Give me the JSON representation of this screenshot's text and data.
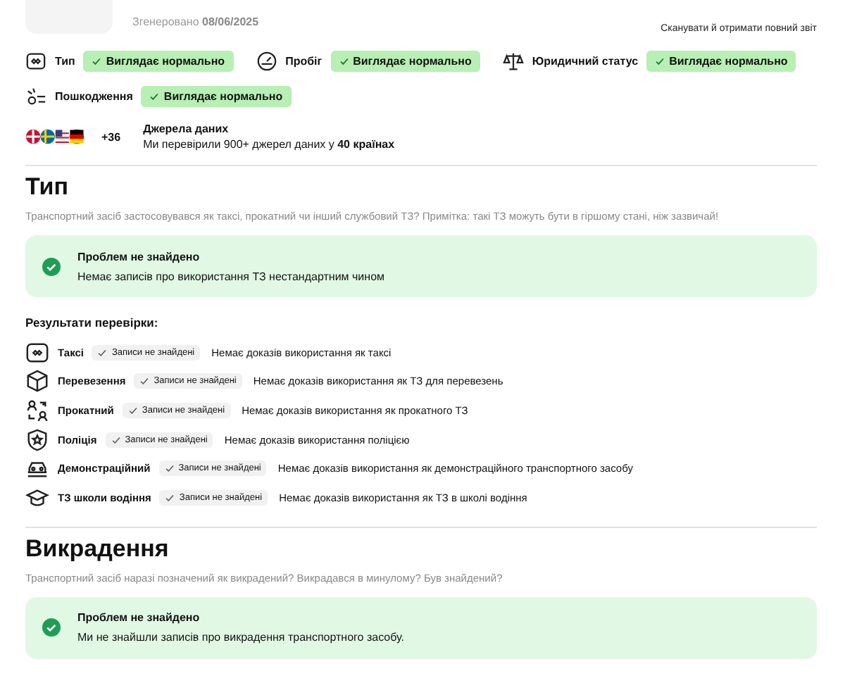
{
  "header": {
    "generated_label": "Згенеровано",
    "generated_date": "08/06/2025",
    "scan_link": "Сканувати й отримати повний звіт"
  },
  "summary": [
    {
      "kind": "type",
      "label": "Тип",
      "status": "Виглядає нормально"
    },
    {
      "kind": "mileage",
      "label": "Пробіг",
      "status": "Виглядає нормально"
    },
    {
      "kind": "legal",
      "label": "Юридичний статус",
      "status": "Виглядає нормально"
    },
    {
      "kind": "damage",
      "label": "Пошкодження",
      "status": "Виглядає нормально"
    }
  ],
  "sources": {
    "extra_count": "+36",
    "title": "Джерела даних",
    "text": "Ми перевірили 900+ джерел даних у **40 країнах**"
  },
  "sections": [
    {
      "title": "Тип",
      "description": "Транспортний засіб застосовувався як таксі, прокатний чи інший службовий ТЗ? Примітка: такі ТЗ можуть бути в гіршому стані, ніж зазвичай!",
      "result": {
        "title": "Проблем не знайдено",
        "text": "Немає записів про використання ТЗ нестандартним чином"
      },
      "checks_title": "Результати перевірки:",
      "checks": [
        {
          "kind": "taxi",
          "label": "Таксі",
          "badge": "Записи не знайдені",
          "text": "Немає доказів використання як таксі"
        },
        {
          "kind": "box",
          "label": "Перевезення",
          "badge": "Записи не знайдені",
          "text": "Немає доказів використання як ТЗ для перевезень"
        },
        {
          "kind": "swap",
          "label": "Прокатний",
          "badge": "Записи не знайдені",
          "text": "Немає доказів використання як прокатного ТЗ"
        },
        {
          "kind": "police",
          "label": "Поліція",
          "badge": "Записи не знайдені",
          "text": "Немає доказів використання поліцією"
        },
        {
          "kind": "car",
          "label": "Демонстраційний",
          "badge": "Записи не знайдені",
          "text": "Немає доказів використання як демонстраційного транспортного засобу"
        },
        {
          "kind": "school",
          "label": "ТЗ школи водіння",
          "badge": "Записи не знайдені",
          "text": "Немає доказів використання як ТЗ в школі водіння"
        }
      ]
    },
    {
      "title": "Викрадення",
      "description": "Транспортний засіб наразі позначений як викрадений? Викрадався в минулому? Був знайдений?",
      "result": {
        "title": "Проблем не знайдено",
        "text": "Ми не знайшли записів про викрадення транспортного засобу."
      }
    }
  ]
}
